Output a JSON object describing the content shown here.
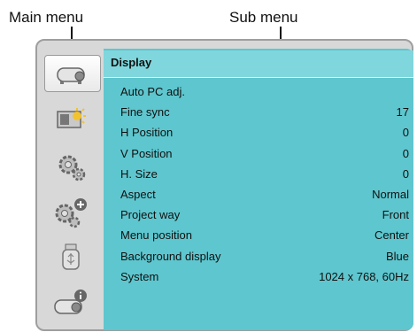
{
  "callouts": {
    "main_menu": "Main menu",
    "sub_menu": "Sub menu"
  },
  "main_menu": {
    "items": [
      {
        "icon": "display-icon",
        "active": true
      },
      {
        "icon": "image-adjust-icon",
        "active": false
      },
      {
        "icon": "setting-gear-icon",
        "active": false
      },
      {
        "icon": "expanded-setting-icon",
        "active": false
      },
      {
        "icon": "usb-memory-icon",
        "active": false
      },
      {
        "icon": "information-icon",
        "active": false
      }
    ]
  },
  "sub_menu": {
    "title": "Display",
    "rows": [
      {
        "label": "Auto PC adj.",
        "value": ""
      },
      {
        "label": "Fine sync",
        "value": "17"
      },
      {
        "label": "H Position",
        "value": "0"
      },
      {
        "label": "V Position",
        "value": "0"
      },
      {
        "label": "H. Size",
        "value": "0"
      },
      {
        "label": "Aspect",
        "value": "Normal"
      },
      {
        "label": "Project way",
        "value": "Front"
      },
      {
        "label": "Menu position",
        "value": "Center"
      },
      {
        "label": "Background display",
        "value": "Blue"
      },
      {
        "label": "System",
        "value": "1024 x 768, 60Hz"
      }
    ]
  },
  "colors": {
    "panel": "#5ec6ce",
    "header": "#7fd6dc",
    "frame": "#d8d8d8"
  }
}
